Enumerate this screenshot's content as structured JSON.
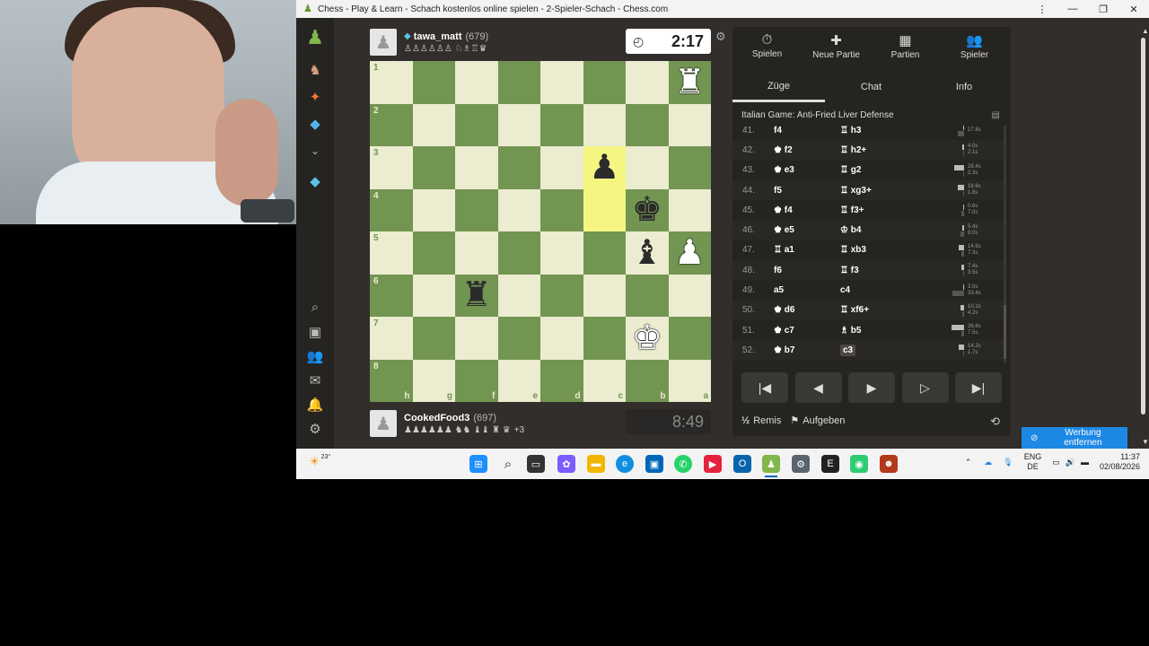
{
  "window": {
    "title": "Chess - Play & Learn - Schach kostenlos online spielen - 2-Spieler-Schach - Chess.com"
  },
  "top_player": {
    "name": "tawa_matt",
    "rating": "(679)",
    "captured": "♙♙♙♙♙♙ ♘♗♖♛",
    "clock": "2:17"
  },
  "bottom_player": {
    "name": "CookedFood3",
    "rating": "(697)",
    "captured": "♟♟♟♟♟♟ ♞♞ ♝♝ ♜ ♛",
    "advantage": "+3",
    "clock": "8:49"
  },
  "board": {
    "ranks": [
      "1",
      "2",
      "3",
      "4",
      "5",
      "6",
      "7",
      "8"
    ],
    "files": [
      "h",
      "g",
      "f",
      "e",
      "d",
      "c",
      "b",
      "a"
    ],
    "pieces": [
      {
        "sq": "a1",
        "glyph": "♜",
        "color": "w"
      },
      {
        "sq": "c3",
        "glyph": "♟",
        "color": "b"
      },
      {
        "sq": "b4",
        "glyph": "♚",
        "color": "b"
      },
      {
        "sq": "b5",
        "glyph": "♝",
        "color": "b"
      },
      {
        "sq": "a5",
        "glyph": "♟",
        "color": "w"
      },
      {
        "sq": "f6",
        "glyph": "♜",
        "color": "b"
      },
      {
        "sq": "b7",
        "glyph": "♚",
        "color": "w"
      }
    ],
    "highlight": [
      "c3",
      "c4"
    ]
  },
  "panel": {
    "nav_tabs": [
      {
        "icon": "⏱",
        "label": "Spielen"
      },
      {
        "icon": "✚",
        "label": "Neue Partie"
      },
      {
        "icon": "▦",
        "label": "Partien"
      },
      {
        "icon": "👥",
        "label": "Spieler"
      }
    ],
    "sub_tabs": [
      "Züge",
      "Chat",
      "Info"
    ],
    "opening": "Italian Game: Anti-Fried Liver Defense",
    "moves": [
      {
        "n": "41.",
        "w": "f4",
        "b": "♖ h3",
        "t1": "",
        "t2": "17.8s"
      },
      {
        "n": "42.",
        "w": "♚ f2",
        "b": "♖ h2+",
        "t1": "4.0s",
        "t2": "2.1s"
      },
      {
        "n": "43.",
        "w": "♚ e3",
        "b": "♖ g2",
        "t1": "28.4s",
        "t2": "2.3s"
      },
      {
        "n": "44.",
        "w": "f5",
        "b": "♖ xg3+",
        "t1": "18.6s",
        "t2": "1.8s"
      },
      {
        "n": "45.",
        "w": "♚ f4",
        "b": "♖ f3+",
        "t1": "0.6s",
        "t2": "7.0s"
      },
      {
        "n": "46.",
        "w": "♚ e5",
        "b": "♔ b4",
        "t1": "5.4s",
        "t2": "9.0s"
      },
      {
        "n": "47.",
        "w": "♖ a1",
        "b": "♖ xb3",
        "t1": "14.6s",
        "t2": "7.3s"
      },
      {
        "n": "48.",
        "w": "f6",
        "b": "♖ f3",
        "t1": "7.4s",
        "t2": "3.5s"
      },
      {
        "n": "49.",
        "w": "a5",
        "b": "c4",
        "t1": "3.0s",
        "t2": "33.4s"
      },
      {
        "n": "50.",
        "w": "♚ d6",
        "b": "♖ xf6+",
        "t1": "10.1s",
        "t2": "4.2s"
      },
      {
        "n": "51.",
        "w": "♚ c7",
        "b": "♗ b5",
        "t1": "36.6s",
        "t2": "7.5s"
      },
      {
        "n": "52.",
        "w": "♚ b7",
        "b": "c3",
        "t1": "14.2s",
        "t2": "1.7s"
      }
    ],
    "draw_label": "Remis",
    "draw_half": "½",
    "resign_label": "Aufgeben"
  },
  "ad": {
    "label": "Werbung entfernen"
  },
  "taskbar": {
    "weather": "23°",
    "lang1": "ENG",
    "lang2": "DE",
    "time": "11:37",
    "date": "02/08/2026"
  }
}
